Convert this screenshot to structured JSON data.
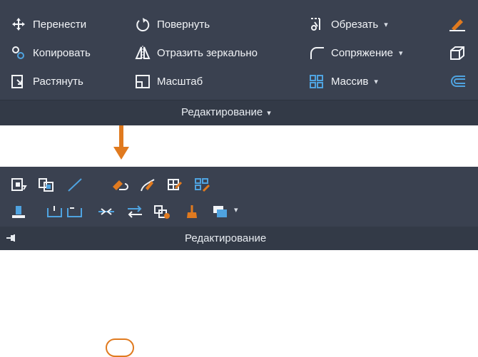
{
  "top_panel": {
    "tools": [
      {
        "label": "Перенести",
        "icon": "move-icon"
      },
      {
        "label": "Повернуть",
        "icon": "rotate-icon"
      },
      {
        "label": "Обрезать",
        "icon": "trim-icon",
        "dropdown": "▾"
      },
      {
        "label": "Копировать",
        "icon": "copy-icon"
      },
      {
        "label": "Отразить зеркально",
        "icon": "mirror-icon"
      },
      {
        "label": "Сопряжение",
        "icon": "fillet-icon",
        "dropdown": "▾"
      },
      {
        "label": "Растянуть",
        "icon": "stretch-icon"
      },
      {
        "label": "Масштаб",
        "icon": "scale-icon"
      },
      {
        "label": "Массив",
        "icon": "array-icon",
        "dropdown": "▾"
      }
    ],
    "footer_label": "Редактирование",
    "footer_caret": "▾"
  },
  "bottom_panel": {
    "footer_label": "Редактирование",
    "dropdown": "▾"
  },
  "colors": {
    "panel_bg": "#3a4150",
    "footer_bg": "#333a47",
    "accent": "#e07a1f",
    "icon_blue": "#4fa3e0"
  }
}
